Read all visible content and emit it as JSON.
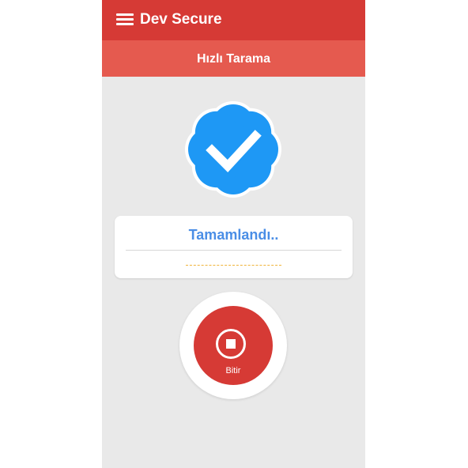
{
  "app": {
    "title": "Dev Secure"
  },
  "header": {
    "subtitle": "Hızlı Tarama"
  },
  "scan": {
    "status": "Tamamlandı.."
  },
  "action": {
    "stop_label": "Bitir"
  },
  "icons": {
    "menu": "hamburger-menu-icon",
    "verified": "verified-check-badge-icon",
    "stop": "stop-icon"
  },
  "colors": {
    "appbar": "#d63a35",
    "subbar": "#e55a4f",
    "badge": "#1e98f5",
    "status_text": "#4a8ee6",
    "progress_dashes": "#f0b43a"
  }
}
